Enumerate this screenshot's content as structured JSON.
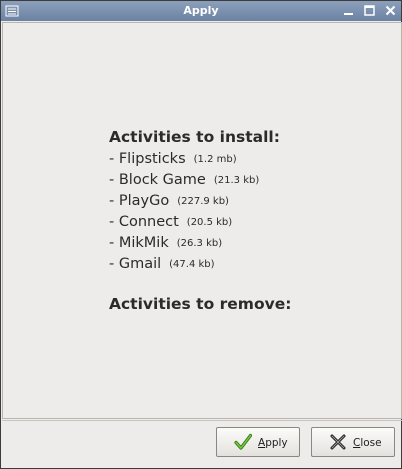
{
  "window": {
    "title": "Apply"
  },
  "install": {
    "heading": "Activities to install:",
    "items": [
      {
        "name": "- Flipsticks",
        "size": "(1.2 mb)"
      },
      {
        "name": "- Block Game",
        "size": "(21.3 kb)"
      },
      {
        "name": "- PlayGo",
        "size": "(227.9 kb)"
      },
      {
        "name": "- Connect",
        "size": "(20.5 kb)"
      },
      {
        "name": "- MikMik",
        "size": "(26.3 kb)"
      },
      {
        "name": "- Gmail",
        "size": "(47.4 kb)"
      }
    ]
  },
  "remove": {
    "heading": "Activities to remove:"
  },
  "buttons": {
    "apply_label_mnemonic": "A",
    "apply_label_rest": "pply",
    "close_label_mnemonic": "C",
    "close_label_rest": "lose"
  },
  "colors": {
    "titlebar": "#7a8fad",
    "background": "#edeceb",
    "apply_icon": "#3f9a1f",
    "close_icon": "#1e1e1e"
  },
  "icons": {
    "window_menu": "window-menu-icon",
    "minimize": "minimize-icon",
    "maximize": "maximize-icon",
    "close": "close-icon",
    "apply": "checkmark-icon",
    "close_button": "x-mark-icon"
  }
}
